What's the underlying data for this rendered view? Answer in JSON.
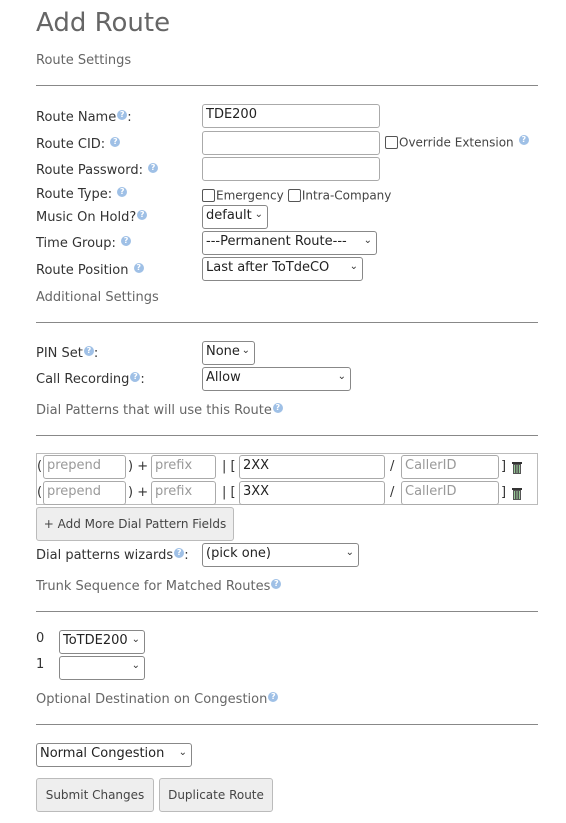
{
  "page": {
    "title": "Add Route"
  },
  "sections": {
    "route_settings": "Route Settings",
    "additional_settings": "Additional Settings",
    "dial_patterns": "Dial Patterns that will use this Route",
    "trunk_sequence": "Trunk Sequence for Matched Routes",
    "optional_destination": "Optional Destination on Congestion"
  },
  "route": {
    "name_label": "Route Name",
    "name_value": "TDE200",
    "cid_label": "Route CID:",
    "cid_value": "",
    "override_label": "Override Extension",
    "password_label": "Route Password:",
    "password_value": "",
    "type_label": "Route Type:",
    "type_emergency": "Emergency",
    "type_intra": "Intra-Company",
    "moh_label": "Music On Hold?",
    "moh_value": "default",
    "time_group_label": "Time Group:",
    "time_group_value": "---Permanent Route---",
    "position_label": "Route Position",
    "position_value": "Last after ToTdeCO"
  },
  "additional": {
    "pin_label": "PIN Set",
    "pin_value": "None",
    "recording_label": "Call Recording",
    "recording_value": "Allow"
  },
  "dial_patterns": {
    "rows": [
      {
        "prepend_ph": "prepend",
        "prefix_ph": "prefix",
        "match": "2XX",
        "callerid_ph": "CallerID"
      },
      {
        "prepend_ph": "prepend",
        "prefix_ph": "prefix",
        "match": "3XX",
        "callerid_ph": "CallerID"
      }
    ],
    "add_more_label": "+ Add More Dial Pattern Fields",
    "wizards_label": "Dial patterns wizards",
    "wizards_value": "(pick one)"
  },
  "trunks": [
    {
      "index": "0",
      "value": "ToTDE200"
    },
    {
      "index": "1",
      "value": ""
    }
  ],
  "congestion": {
    "value": "Normal Congestion"
  },
  "buttons": {
    "submit": "Submit Changes",
    "duplicate": "Duplicate Route"
  },
  "colors": {
    "help_icon": "#9fc0e6",
    "rule": "#888888"
  }
}
